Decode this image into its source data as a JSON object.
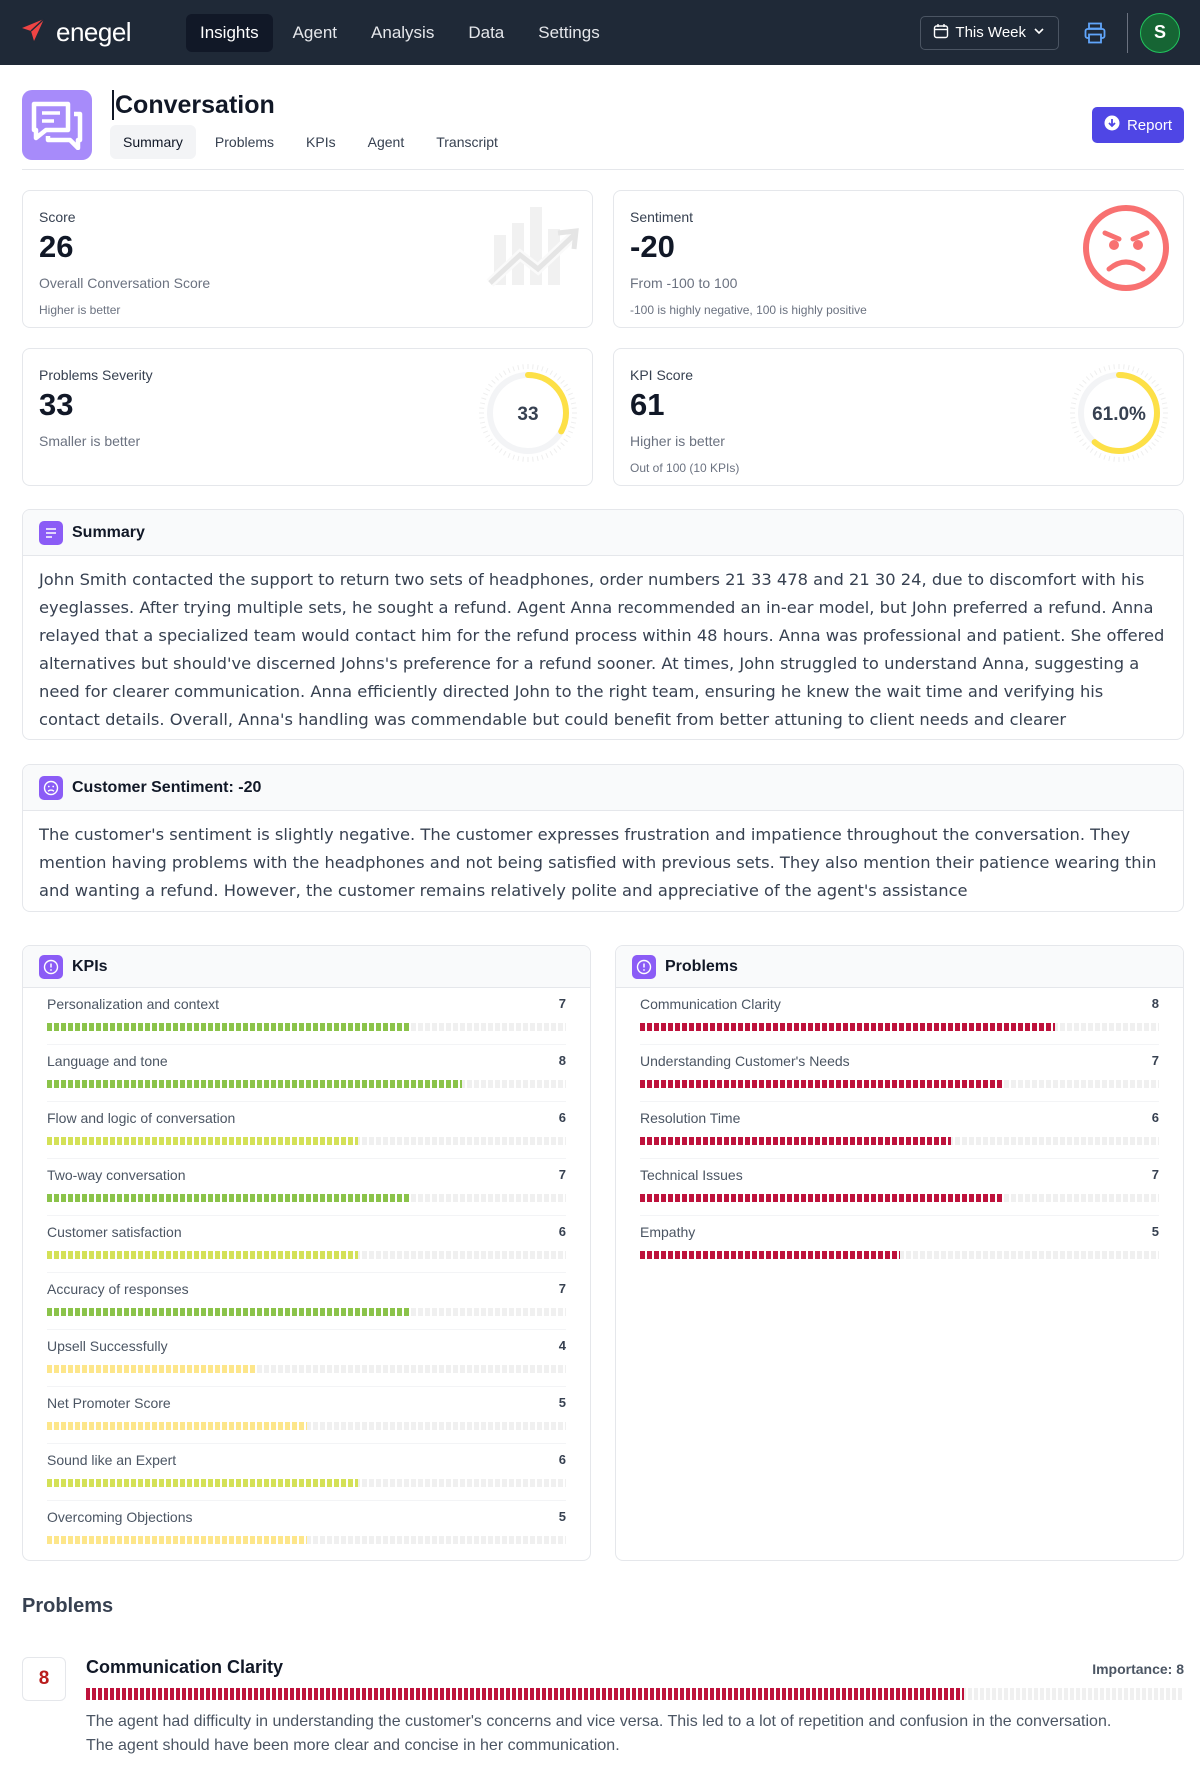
{
  "nav": {
    "brand": "enegel",
    "tabs": [
      {
        "label": "Insights",
        "active": true
      },
      {
        "label": "Agent",
        "active": false
      },
      {
        "label": "Analysis",
        "active": false
      },
      {
        "label": "Data",
        "active": false
      },
      {
        "label": "Settings",
        "active": false
      }
    ],
    "date_filter": "This Week",
    "avatar_initial": "S",
    "icons": {
      "logo": "paper-plane-icon",
      "calendar": "calendar-icon",
      "chevron": "chevron-down-icon",
      "print": "printer-icon"
    }
  },
  "header": {
    "title": "Conversation",
    "tabs": [
      {
        "label": "Summary",
        "active": true
      },
      {
        "label": "Problems",
        "active": false
      },
      {
        "label": "KPIs",
        "active": false
      },
      {
        "label": "Agent",
        "active": false
      },
      {
        "label": "Transcript",
        "active": false
      }
    ],
    "report_label": "Report"
  },
  "stats": {
    "score": {
      "label": "Score",
      "value": "26",
      "sub": "Overall Conversation Score",
      "note": "Higher is better"
    },
    "sentiment": {
      "label": "Sentiment",
      "value": "-20",
      "sub": "From -100 to 100",
      "note": "-100 is highly negative, 100 is highly positive"
    },
    "severity": {
      "label": "Problems Severity",
      "value": "33",
      "sub": "Smaller is better",
      "gauge_text": "33",
      "gauge_fraction": 0.33
    },
    "kpi": {
      "label": "KPI Score",
      "value": "61",
      "sub": "Higher is better",
      "note": "Out of 100 (10 KPIs)",
      "gauge_text": "61.0%",
      "gauge_fraction": 0.61
    }
  },
  "summary": {
    "title": "Summary",
    "text": "John Smith contacted the support to return two sets of headphones, order numbers 21 33 478 and 21 30 24, due to discomfort with his eyeglasses. After trying multiple sets, he sought a refund. Agent Anna recommended an in-ear model, but John preferred a refund. Anna relayed that a specialized team would contact him for the refund process within 48 hours. Anna was professional and patient. She offered alternatives but should've discerned Johns's preference for a refund sooner. At times, John struggled to understand Anna, suggesting a need for clearer communication. Anna efficiently directed John to the right team, ensuring he knew the wait time and verifying his contact details. Overall, Anna's handling was commendable but could benefit from better attuning to client needs and clearer communication."
  },
  "customer_sentiment": {
    "title": "Customer Sentiment: -20",
    "text": "The customer's sentiment is slightly negative. The customer expresses frustration and impatience throughout the conversation. They mention having problems with the headphones and not being satisfied with previous sets. They also mention their patience wearing thin and wanting a refund. However, the customer remains relatively polite and appreciative of the agent's assistance"
  },
  "kpis": {
    "title": "KPIs",
    "items": [
      {
        "label": "Personalization and context",
        "value": "7"
      },
      {
        "label": "Language and tone",
        "value": "8"
      },
      {
        "label": "Flow and logic of conversation",
        "value": "6"
      },
      {
        "label": "Two-way conversation",
        "value": "7"
      },
      {
        "label": "Customer satisfaction",
        "value": "6"
      },
      {
        "label": "Accuracy of responses",
        "value": "7"
      },
      {
        "label": "Upsell Successfully",
        "value": "4"
      },
      {
        "label": "Net Promoter Score",
        "value": "5"
      },
      {
        "label": "Sound like an Expert",
        "value": "6"
      },
      {
        "label": "Overcoming Objections",
        "value": "5"
      }
    ]
  },
  "problems": {
    "title": "Problems",
    "items": [
      {
        "label": "Communication Clarity",
        "value": "8"
      },
      {
        "label": "Understanding Customer's Needs",
        "value": "7"
      },
      {
        "label": "Resolution Time",
        "value": "6"
      },
      {
        "label": "Technical Issues",
        "value": "7"
      },
      {
        "label": "Empathy",
        "value": "5"
      }
    ]
  },
  "problem_details": {
    "heading": "Problems",
    "items": [
      {
        "score": "8",
        "title": "Communication Clarity",
        "importance": "Importance: 8",
        "description": "The agent had difficulty in understanding the customer's concerns and vice versa. This led to a lot of repetition and confusion in the conversation. The agent should have been more clear and concise in her communication."
      }
    ]
  },
  "colors": {
    "nav_bg": "#1f2937",
    "accent": "#4f46e5",
    "purple": "#a78bfa",
    "kpi_high": "#8bc34a",
    "kpi_mid": "#d4e157",
    "kpi_low": "#fde68a",
    "problem": "#be123c",
    "gauge": "#fde047",
    "sad_face": "#f87171"
  }
}
